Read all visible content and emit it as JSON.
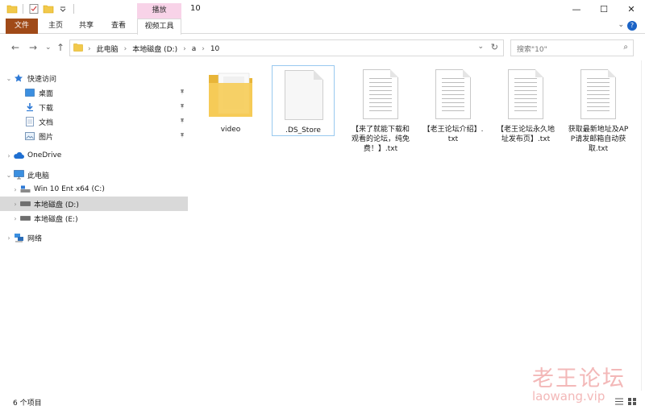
{
  "window": {
    "title": "10",
    "context_tab": "播放",
    "controls": {
      "minimize": "—",
      "maximize": "☐",
      "close": "✕"
    }
  },
  "ribbon": {
    "file": "文件",
    "home": "主页",
    "share": "共享",
    "view": "查看",
    "video_tools": "视频工具",
    "expand": "⌄",
    "help": "?"
  },
  "nav": {
    "back": "←",
    "forward": "→",
    "recent": "⌄",
    "up": "↑"
  },
  "address": {
    "crumbs": [
      "此电脑",
      "本地磁盘 (D:)",
      "a",
      "10"
    ],
    "separator": "›",
    "dropdown": "⌄",
    "refresh": "↻"
  },
  "search": {
    "placeholder": "搜索\"10\"",
    "icon": "⌕"
  },
  "sidebar": {
    "quick_access": "快速访问",
    "desktop": "桌面",
    "downloads": "下载",
    "documents": "文档",
    "pictures": "图片",
    "onedrive": "OneDrive",
    "this_pc": "此电脑",
    "drive_c": "Win 10 Ent x64 (C:)",
    "drive_d": "本地磁盘 (D:)",
    "drive_e": "本地磁盘 (E:)",
    "network": "网络",
    "pin": "📌"
  },
  "files": [
    {
      "name": "video",
      "type": "folder"
    },
    {
      "name": ".DS_Store",
      "type": "blank"
    },
    {
      "name": "【来了就能下载和观看的论坛，纯免费！】.txt",
      "type": "txt"
    },
    {
      "name": "【老王论坛介绍】.txt",
      "type": "txt"
    },
    {
      "name": "【老王论坛永久地址发布页】.txt",
      "type": "txt"
    },
    {
      "name": "获取最新地址及APP请发邮箱自动获取.txt",
      "type": "txt"
    }
  ],
  "status": {
    "count": "6 个项目"
  },
  "watermark": {
    "cn": "老王论坛",
    "en": "laowang.vip"
  }
}
